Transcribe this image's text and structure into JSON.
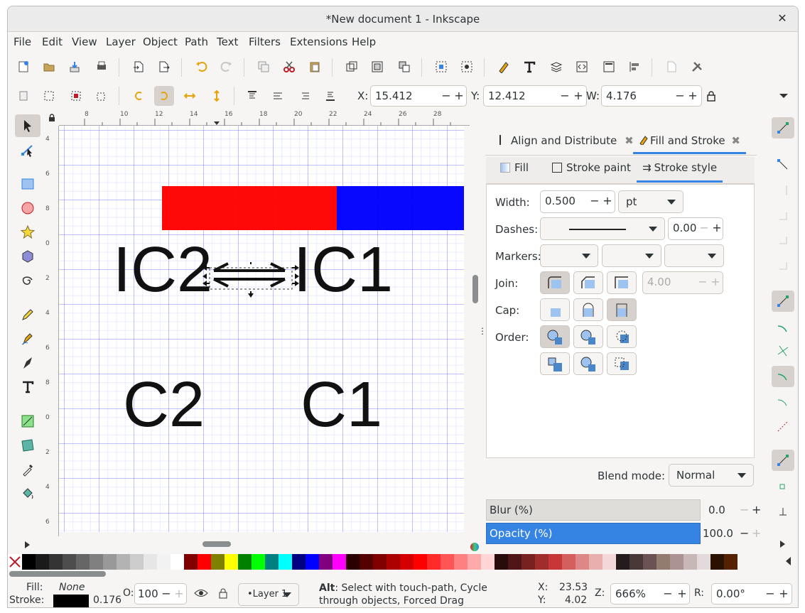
{
  "window": {
    "title": "*New document 1 - Inkscape"
  },
  "menu": [
    "File",
    "Edit",
    "View",
    "Layer",
    "Object",
    "Path",
    "Text",
    "Filters",
    "Extensions",
    "Help"
  ],
  "toolbar": {
    "x_label": "X:",
    "x_value": "15.412",
    "y_label": "Y:",
    "y_value": "12.412",
    "w_label": "W:",
    "w_value": "4.176"
  },
  "ruler": {
    "h_ticks": [
      "8",
      "10",
      "12",
      "14",
      "16",
      "18",
      "20",
      "22",
      "24",
      "26",
      "28"
    ],
    "v_ticks": [
      "4",
      "6",
      "8",
      "0",
      "2",
      "4",
      "6",
      "8",
      "0",
      "2",
      "4",
      "6"
    ]
  },
  "canvas": {
    "texts": {
      "ic2": "IC2",
      "ic1": "IC1",
      "c2": "C2",
      "c1": "C1"
    },
    "colors": {
      "red_bar": "#ff0000",
      "blue_bar": "#0000ff"
    }
  },
  "dock": {
    "tabs": [
      {
        "label": "Align and Distribute"
      },
      {
        "label": "Fill and Stroke"
      }
    ],
    "subtabs": [
      {
        "label": "Fill"
      },
      {
        "label": "Stroke paint"
      },
      {
        "label": "Stroke style"
      }
    ],
    "width_label": "Width:",
    "width_value": "0.500",
    "unit": "pt",
    "dashes_label": "Dashes:",
    "dash_offset": "0.00",
    "markers_label": "Markers:",
    "join_label": "Join:",
    "miter_value": "4.00",
    "cap_label": "Cap:",
    "order_label": "Order:",
    "blend_label": "Blend mode:",
    "blend_value": "Normal",
    "blur_label": "Blur (%)",
    "blur_value": "0.0",
    "opacity_label": "Opacity (%)",
    "opacity_value": "100.0"
  },
  "status": {
    "fill_label": "Fill:",
    "fill_value": "None",
    "stroke_label": "Stroke:",
    "stroke_width": "0.176",
    "o_label": "O:",
    "o_value": "100",
    "layer": "•Layer 1",
    "msg_bold": "Alt",
    "msg_rest": ": Select with touch-path, Cycle through objects, Forced Drag",
    "x_label": "X:",
    "x_value": "23.53",
    "y_label": "Y:",
    "y_value": "4.02",
    "z_label": "Z:",
    "zoom": "666%",
    "r_label": "R:",
    "rotation": "0.00°"
  },
  "palette": [
    "#000000",
    "#1a1a1a",
    "#333333",
    "#4d4d4d",
    "#666666",
    "#808080",
    "#999999",
    "#b3b3b3",
    "#cccccc",
    "#e6e6e6",
    "#f2f2f2",
    "#ffffff",
    "#800000",
    "#ff0000",
    "#808000",
    "#ffff00",
    "#008000",
    "#00ff00",
    "#008080",
    "#00ffff",
    "#000080",
    "#0000ff",
    "#800080",
    "#ff00ff",
    "#2b0000",
    "#550000",
    "#800000",
    "#aa0000",
    "#d40000",
    "#ff0000",
    "#ff2a2a",
    "#ff5555",
    "#ff8080",
    "#ffaaaa",
    "#ffd5d5",
    "#280b0b",
    "#501616",
    "#782121",
    "#a02c2c",
    "#c83737",
    "#d35f5f",
    "#de8787",
    "#e9afaf",
    "#f4d7d7",
    "#241c1c",
    "#483737",
    "#6c5353",
    "#917c6f",
    "#ac9393",
    "#c8b7b7",
    "#e3dbdb",
    "#2b1100",
    "#552200"
  ]
}
